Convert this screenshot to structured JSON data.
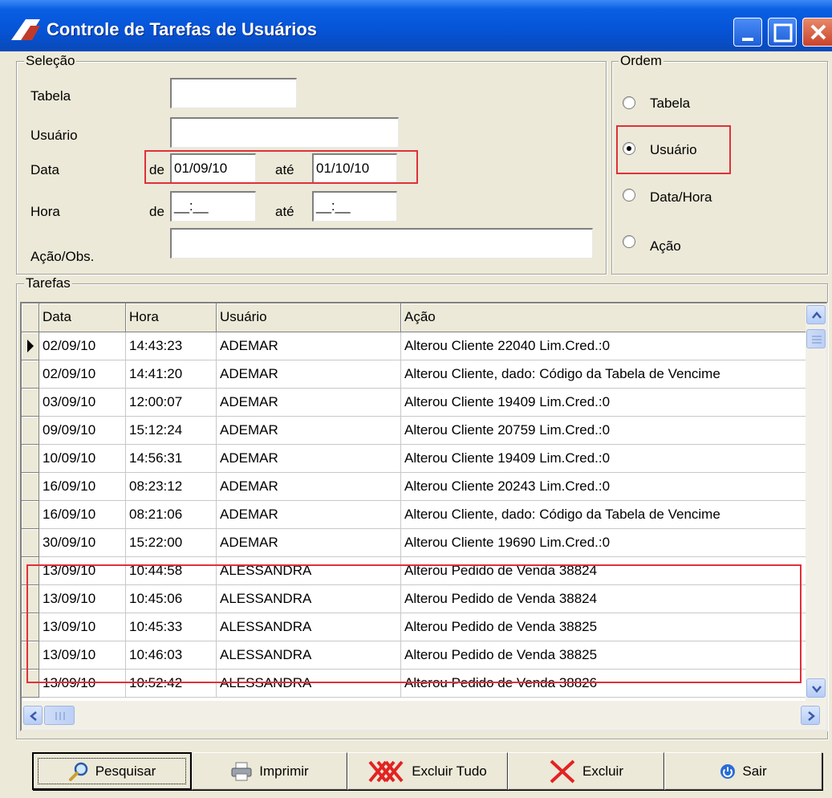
{
  "window": {
    "title": "Controle de Tarefas de Usuários"
  },
  "selecao": {
    "legend": "Seleção",
    "tabela_label": "Tabela",
    "tabela_value": "",
    "usuario_label": "Usuário",
    "usuario_value": "",
    "data_label": "Data",
    "data_de_label": "de",
    "data_de_value": "01/09/10",
    "data_ate_label": "até",
    "data_ate_value": "01/10/10",
    "hora_label": "Hora",
    "hora_de_label": "de",
    "hora_de_value": "__:__",
    "hora_ate_label": "até",
    "hora_ate_value": "__:__",
    "acao_label": "Ação/Obs.",
    "acao_value": ""
  },
  "ordem": {
    "legend": "Ordem",
    "options": [
      "Tabela",
      "Usuário",
      "Data/Hora",
      "Ação"
    ],
    "selected": "Usuário"
  },
  "tarefas": {
    "legend": "Tarefas",
    "columns": [
      "Data",
      "Hora",
      "Usuário",
      "Ação"
    ],
    "rows": [
      [
        "02/09/10",
        "14:43:23",
        "ADEMAR",
        "Alterou Cliente 22040 Lim.Cred.:0"
      ],
      [
        "02/09/10",
        "14:41:20",
        "ADEMAR",
        "Alterou Cliente, dado: Código da Tabela de Vencime"
      ],
      [
        "03/09/10",
        "12:00:07",
        "ADEMAR",
        "Alterou Cliente 19409 Lim.Cred.:0"
      ],
      [
        "09/09/10",
        "15:12:24",
        "ADEMAR",
        "Alterou Cliente 20759 Lim.Cred.:0"
      ],
      [
        "10/09/10",
        "14:56:31",
        "ADEMAR",
        "Alterou Cliente 19409 Lim.Cred.:0"
      ],
      [
        "16/09/10",
        "08:23:12",
        "ADEMAR",
        "Alterou Cliente 20243 Lim.Cred.:0"
      ],
      [
        "16/09/10",
        "08:21:06",
        "ADEMAR",
        "Alterou Cliente, dado: Código da Tabela de Vencime"
      ],
      [
        "30/09/10",
        "15:22:00",
        "ADEMAR",
        "Alterou Cliente 19690 Lim.Cred.:0"
      ],
      [
        "13/09/10",
        "10:44:58",
        "ALESSANDRA",
        "Alterou Pedido de Venda 38824"
      ],
      [
        "13/09/10",
        "10:45:06",
        "ALESSANDRA",
        "Alterou Pedido de Venda 38824"
      ],
      [
        "13/09/10",
        "10:45:33",
        "ALESSANDRA",
        "Alterou Pedido de Venda 38825"
      ],
      [
        "13/09/10",
        "10:46:03",
        "ALESSANDRA",
        "Alterou Pedido de Venda 38825"
      ],
      [
        "13/09/10",
        "10:52:42",
        "ALESSANDRA",
        "Alterou Pedido de Venda 38826"
      ]
    ]
  },
  "buttons": {
    "pesquisar": "Pesquisar",
    "imprimir": "Imprimir",
    "excluir_tudo": "Excluir Tudo",
    "excluir": "Excluir",
    "sair": "Sair"
  },
  "colors": {
    "highlight": "#e0303a",
    "title_bar": "#0553d6"
  }
}
